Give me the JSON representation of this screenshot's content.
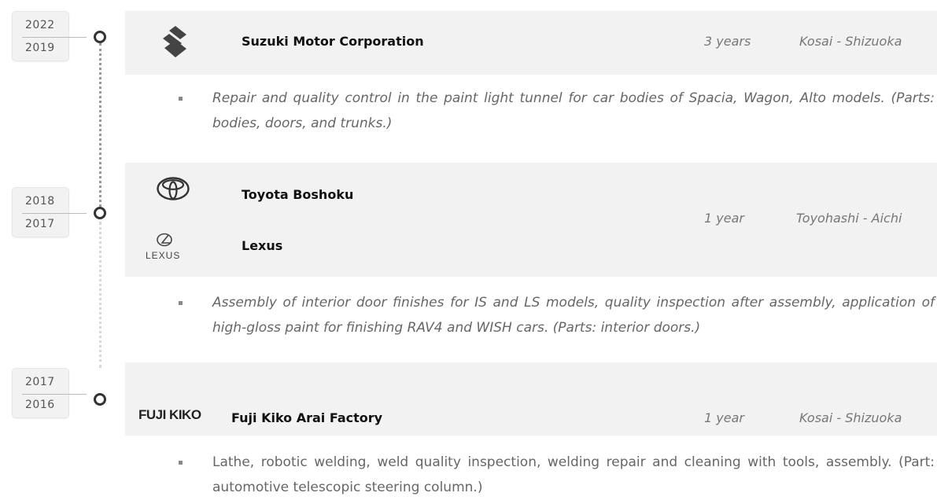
{
  "entries": [
    {
      "year_end": "2022",
      "year_start": "2019",
      "company": "Suzuki Motor Corporation",
      "duration": "3 years",
      "location": "Kosai - Shizuoka",
      "logo": "suzuki-logo",
      "description": "Repair and quality control in the paint light tunnel for car bodies of Spacia, Wagon, Alto models. (Parts: bodies, doors, and trunks.)"
    },
    {
      "year_end": "2018",
      "year_start": "2017",
      "company": "Toyota Boshoku",
      "company_secondary": "Lexus",
      "duration": "1 year",
      "location": "Toyohashi - Aichi",
      "logo": "toyota-logo",
      "logo_secondary": "lexus-logo",
      "logo_secondary_text": "LEXUS",
      "description": "Assembly of interior door finishes for IS and LS models, quality inspection after assembly, application of high-gloss paint for finishing RAV4 and WISH cars. (Parts: interior doors.)"
    },
    {
      "year_end": "2017",
      "year_start": "2016",
      "company": "Fuji Kiko Arai Factory",
      "duration": "1 year",
      "location": "Kosai - Shizuoka",
      "logo": "fuji-kiko-logo",
      "logo_text": "FUJI KIKO",
      "description": "Lathe, robotic welding, weld quality inspection, welding repair and cleaning with tools, assembly. (Part: automotive telescopic steering column.)"
    }
  ]
}
